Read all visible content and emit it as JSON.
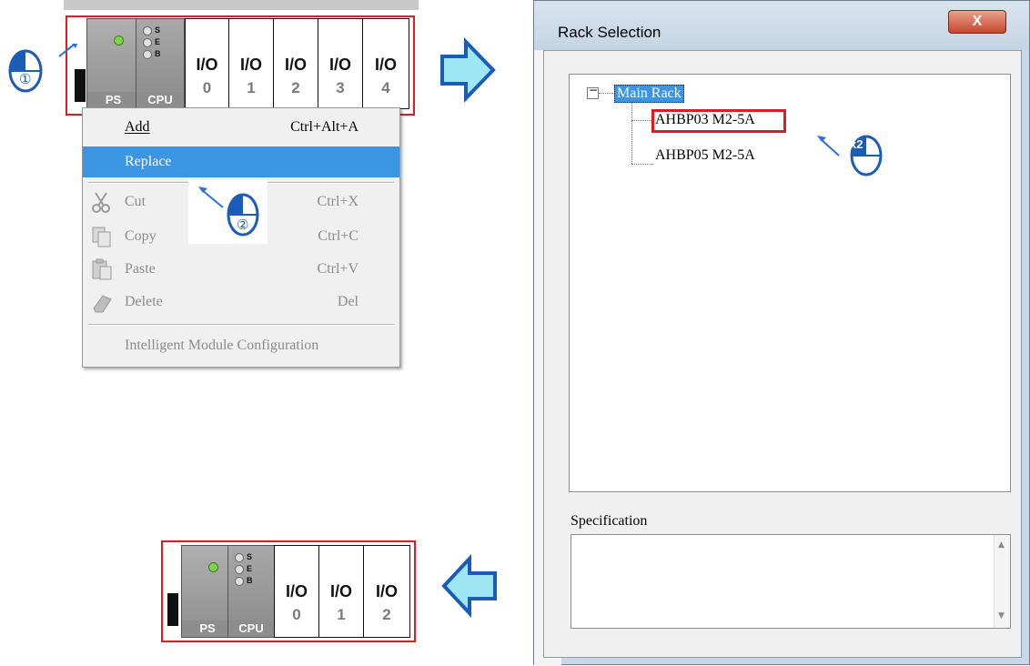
{
  "top_rack": {
    "ps_label": "PS",
    "cpu_label": "CPU",
    "cpu_leds": [
      "S",
      "E",
      "B"
    ],
    "io_modules": [
      {
        "label": "I/O",
        "number": "0"
      },
      {
        "label": "I/O",
        "number": "1"
      },
      {
        "label": "I/O",
        "number": "2"
      },
      {
        "label": "I/O",
        "number": "3"
      },
      {
        "label": "I/O",
        "number": "4"
      }
    ]
  },
  "bottom_rack": {
    "ps_label": "PS",
    "cpu_label": "CPU",
    "cpu_leds": [
      "S",
      "E",
      "B"
    ],
    "io_modules": [
      {
        "label": "I/O",
        "number": "0"
      },
      {
        "label": "I/O",
        "number": "1"
      },
      {
        "label": "I/O",
        "number": "2"
      }
    ]
  },
  "context_menu": {
    "items": [
      {
        "label": "Add",
        "shortcut": "Ctrl+Alt+A",
        "state": "enabled"
      },
      {
        "label": "Replace",
        "shortcut": "",
        "state": "highlighted"
      },
      {
        "label": "Cut",
        "shortcut": "Ctrl+X",
        "state": "disabled",
        "icon": "scissors-icon"
      },
      {
        "label": "Copy",
        "shortcut": "Ctrl+C",
        "state": "disabled",
        "icon": "copy-icon"
      },
      {
        "label": "Paste",
        "shortcut": "Ctrl+V",
        "state": "disabled",
        "icon": "paste-icon"
      },
      {
        "label": "Delete",
        "shortcut": "Del",
        "state": "disabled",
        "icon": "eraser-icon"
      },
      {
        "label": "Intelligent Module Configuration",
        "shortcut": "",
        "state": "disabled"
      }
    ]
  },
  "step_markers": {
    "step1": "①",
    "step2": "②",
    "double_click": "x2"
  },
  "dialog": {
    "title": "Rack Selection",
    "close_label": "X",
    "tree": {
      "expander": "−",
      "root": "Main Rack",
      "children": [
        "AHBP03 M2-5A",
        "AHBP05 M2-5A"
      ]
    },
    "specification_label": "Specification"
  },
  "colors": {
    "highlight": "#3b95e3",
    "red_frame": "#e21b23",
    "arrow_fill": "#9fe6f5",
    "arrow_stroke": "#1b5cb8",
    "dialog_frame": "#c9d8e6"
  }
}
